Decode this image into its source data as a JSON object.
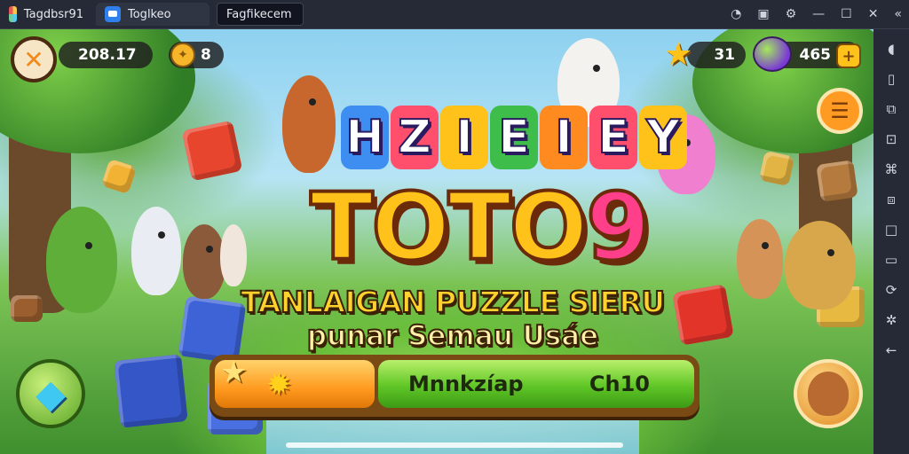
{
  "window": {
    "tabs": [
      {
        "label": "Tagdbsr91"
      },
      {
        "label": "Toglkeo"
      },
      {
        "label": "Fagfikecem"
      }
    ],
    "controls": [
      "settings-icon",
      "screen-icon",
      "gear-icon",
      "minimize-icon",
      "maximize-icon",
      "close-icon",
      "expand-icon"
    ]
  },
  "hud": {
    "back_icon": "back-icon",
    "coins_value": "208.17",
    "gem_count": "8",
    "stars_value": "31",
    "candy_value": "465",
    "add_icon": "plus-icon"
  },
  "title": {
    "top_letters": [
      "H",
      "Z",
      "I",
      "E",
      "I",
      "E",
      "Y"
    ],
    "main_word": "TOTO",
    "main_number": "9",
    "subtitle_line1": "TANLAIGAN PUZZLE SIERU",
    "subtitle_line2": "punar Semau Usáe"
  },
  "play_bar": {
    "left_icon": "star-icon",
    "label": "Mnnkzíap",
    "value": "Ch10"
  },
  "sidebar_icons": [
    "volume-icon",
    "phone-icon",
    "camera-icon",
    "shake-icon",
    "keymap-icon",
    "copy-icon",
    "square-icon",
    "screen-icon",
    "rotate-icon",
    "gear-icon",
    "back-icon"
  ],
  "colors": {
    "accent_orange": "#ff9a1f",
    "accent_green": "#5fc626",
    "title_yellow": "#ffc21a",
    "title_pink": "#ff3f8a"
  }
}
